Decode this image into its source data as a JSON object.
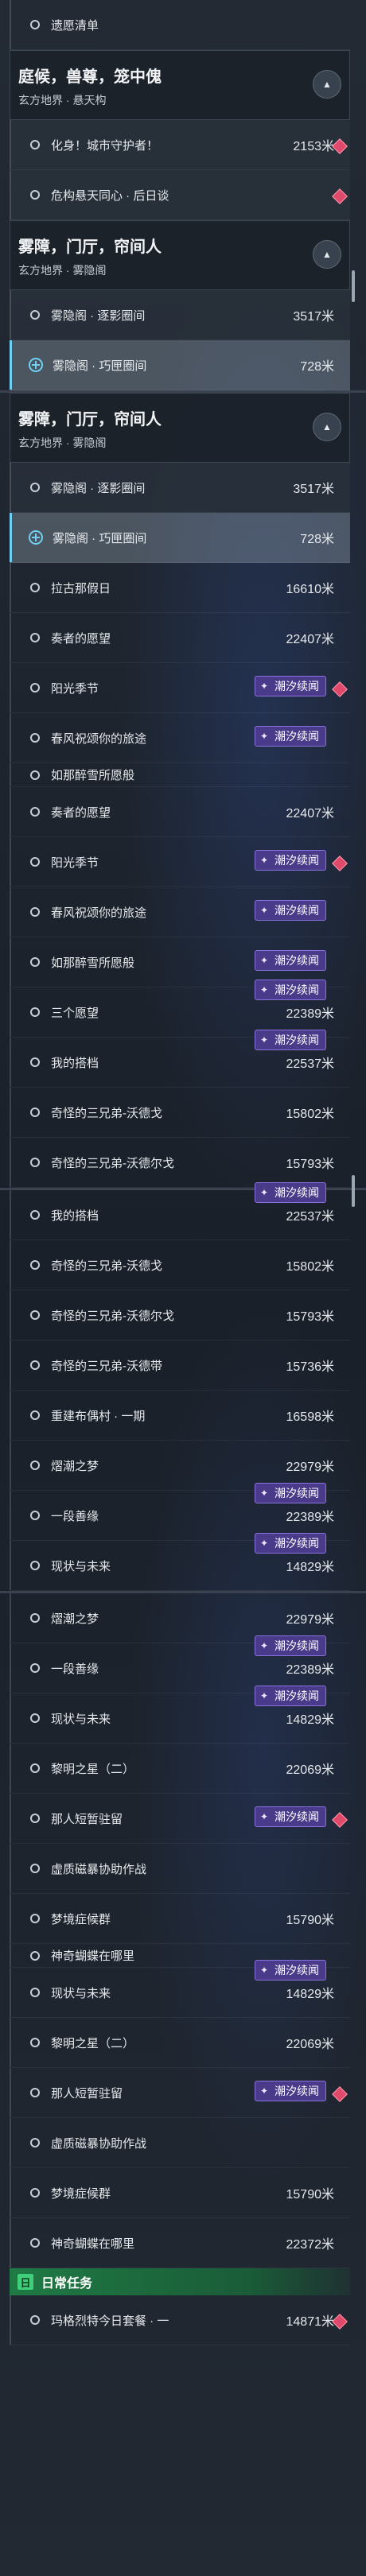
{
  "tag_label": "潮汐续闻",
  "rows": [
    {
      "type": "item",
      "name": "遗愿清单",
      "dist": ""
    },
    {
      "type": "header",
      "title": "庭候，兽尊，笼中傀",
      "subtitle": "玄方地界 · 悬天构"
    },
    {
      "type": "item",
      "name": "化身！城市守护者！",
      "dist": "2153米",
      "diamond": true,
      "panel": true
    },
    {
      "type": "item",
      "name": "危构悬天同心 · 后日谈",
      "dist": "",
      "diamond": true,
      "panel": true
    },
    {
      "type": "header",
      "title": "雾障，门厅，帘间人",
      "subtitle": "玄方地界 · 雾隐阁"
    },
    {
      "type": "item",
      "name": "雾隐阁 · 逐影圈间",
      "dist": "3517米",
      "panel": true
    },
    {
      "type": "sel",
      "name": "雾隐阁 · 巧匣圈间",
      "dist": "728米"
    },
    {
      "type": "gap"
    },
    {
      "type": "header",
      "title": "雾障，门厅，帘间人",
      "subtitle": "玄方地界 · 雾隐阁"
    },
    {
      "type": "item",
      "name": "雾隐阁 · 逐影圈间",
      "dist": "3517米",
      "panel": true
    },
    {
      "type": "sel",
      "name": "雾隐阁 · 巧匣圈间",
      "dist": "728米"
    },
    {
      "type": "item",
      "name": "拉古那假日",
      "dist": "16610米"
    },
    {
      "type": "item",
      "name": "奏者的愿望",
      "dist": "22407米"
    },
    {
      "type": "item",
      "name": "阳光季节",
      "dist": "",
      "tag": true,
      "diamond": true
    },
    {
      "type": "item",
      "name": "春风祝颂你的旅途",
      "dist": "",
      "tag": true
    },
    {
      "type": "cut",
      "name": "如那醉雪所愿般"
    },
    {
      "type": "item",
      "name": "奏者的愿望",
      "dist": "22407米"
    },
    {
      "type": "item",
      "name": "阳光季节",
      "dist": "",
      "tag": true,
      "diamond": true
    },
    {
      "type": "item",
      "name": "春风祝颂你的旅途",
      "dist": "",
      "tag": true
    },
    {
      "type": "item",
      "name": "如那醉雪所愿般",
      "dist": "",
      "tag": true
    },
    {
      "type": "item",
      "name": "三个愿望",
      "dist": "22389米",
      "tagtop": true
    },
    {
      "type": "item",
      "name": "我的搭档",
      "dist": "22537米",
      "tagtop": true
    },
    {
      "type": "item",
      "name": "奇怪的三兄弟-沃德戈",
      "dist": "15802米"
    },
    {
      "type": "item",
      "name": "奇怪的三兄弟-沃德尔戈",
      "dist": "15793米"
    },
    {
      "type": "gap"
    },
    {
      "type": "item",
      "name": "我的搭档",
      "dist": "22537米",
      "tagtop": true
    },
    {
      "type": "item",
      "name": "奇怪的三兄弟-沃德戈",
      "dist": "15802米"
    },
    {
      "type": "item",
      "name": "奇怪的三兄弟-沃德尔戈",
      "dist": "15793米"
    },
    {
      "type": "item",
      "name": "奇怪的三兄弟-沃德带",
      "dist": "15736米"
    },
    {
      "type": "item",
      "name": "重建布偶村 · 一期",
      "dist": "16598米"
    },
    {
      "type": "item",
      "name": "熠潮之梦",
      "dist": "22979米"
    },
    {
      "type": "item",
      "name": "一段善缘",
      "dist": "22389米",
      "tagtop": true
    },
    {
      "type": "item",
      "name": "现状与未来",
      "dist": "14829米",
      "tagtop": true
    },
    {
      "type": "gap"
    },
    {
      "type": "item",
      "name": "熠潮之梦",
      "dist": "22979米"
    },
    {
      "type": "item",
      "name": "一段善缘",
      "dist": "22389米",
      "tagtop": true
    },
    {
      "type": "item",
      "name": "现状与未来",
      "dist": "14829米",
      "tagtop": true
    },
    {
      "type": "item",
      "name": "黎明之星（二）",
      "dist": "22069米"
    },
    {
      "type": "item",
      "name": "那人短暂驻留",
      "dist": "",
      "tag": true,
      "diamond": true
    },
    {
      "type": "item",
      "name": "虚质磁暴协助作战",
      "dist": ""
    },
    {
      "type": "item",
      "name": "梦境症候群",
      "dist": "15790米"
    },
    {
      "type": "cut",
      "name": "神奇蝴蝶在哪里"
    },
    {
      "type": "item",
      "name": "现状与未来",
      "dist": "14829米",
      "tagtop": true
    },
    {
      "type": "item",
      "name": "黎明之星（二）",
      "dist": "22069米"
    },
    {
      "type": "item",
      "name": "那人短暂驻留",
      "dist": "",
      "tag": true,
      "diamond": true
    },
    {
      "type": "item",
      "name": "虚质磁暴协助作战",
      "dist": ""
    },
    {
      "type": "item",
      "name": "梦境症候群",
      "dist": "15790米"
    },
    {
      "type": "item",
      "name": "神奇蝴蝶在哪里",
      "dist": "22372米"
    },
    {
      "type": "daily",
      "name": "日常任务"
    },
    {
      "type": "item",
      "name": "玛格烈特今日套餐 · 一",
      "dist": "14871米",
      "diamond": true
    }
  ]
}
